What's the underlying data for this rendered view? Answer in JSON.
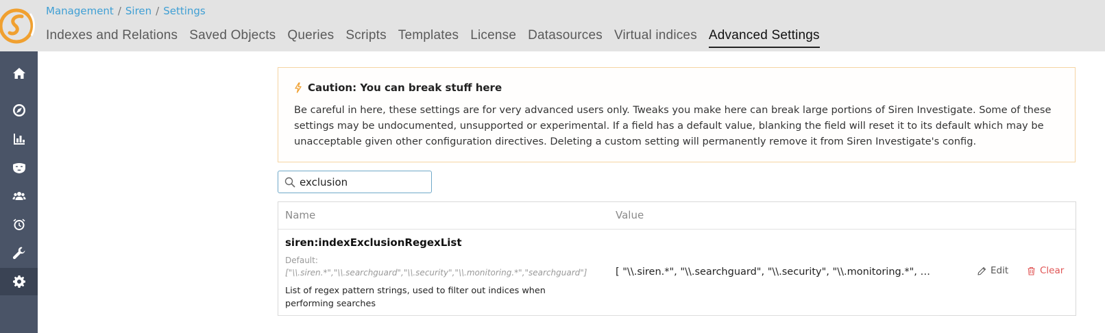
{
  "breadcrumb": {
    "items": [
      "Management",
      "Siren",
      "Settings"
    ],
    "separator": "/"
  },
  "tabs": [
    {
      "label": "Indexes and Relations",
      "active": false
    },
    {
      "label": "Saved Objects",
      "active": false
    },
    {
      "label": "Queries",
      "active": false
    },
    {
      "label": "Scripts",
      "active": false
    },
    {
      "label": "Templates",
      "active": false
    },
    {
      "label": "License",
      "active": false
    },
    {
      "label": "Datasources",
      "active": false
    },
    {
      "label": "Virtual indices",
      "active": false
    },
    {
      "label": "Advanced Settings",
      "active": true
    }
  ],
  "sidebar": {
    "items": [
      {
        "icon": "home-icon"
      },
      {
        "icon": "compass-icon"
      },
      {
        "icon": "bar-chart-icon"
      },
      {
        "icon": "mask-icon"
      },
      {
        "icon": "users-icon"
      },
      {
        "icon": "alarm-clock-icon"
      },
      {
        "icon": "wrench-icon"
      },
      {
        "icon": "gear-icon",
        "active": true
      }
    ]
  },
  "caution": {
    "title": "Caution: You can break stuff here",
    "body": "Be careful in here, these settings are for very advanced users only. Tweaks you make here can break large portions of Siren Investigate. Some of these settings may be undocumented, unsupported or experimental. If a field has a default value, blanking the field will reset it to its default which may be unacceptable given other configuration directives. Deleting a custom setting will permanently remove it from Siren Investigate's config."
  },
  "search": {
    "value": "exclusion"
  },
  "table": {
    "headers": {
      "name": "Name",
      "value": "Value"
    },
    "rows": [
      {
        "name": "siren:indexExclusionRegexList",
        "default_label": "Default:",
        "default_value": "[\"\\\\.siren.*\",\"\\\\.searchguard\",\"\\\\.security\",\"\\\\.monitoring.*\",\"searchguard\"]",
        "description": "List of regex pattern strings, used to filter out indices when performing searches",
        "value": "[ \"\\\\.siren.*\", \"\\\\.searchguard\", \"\\\\.security\", \"\\\\.monitoring.*\", \"s...",
        "edit_label": "Edit",
        "clear_label": "Clear"
      }
    ]
  },
  "colors": {
    "sidebar": "#4a5467",
    "topbar": "#e3e3e3",
    "link": "#3f9fd4",
    "caution_border": "#f5d4a3",
    "logo_orange": "#f0a030",
    "clear_red": "#e05555"
  }
}
